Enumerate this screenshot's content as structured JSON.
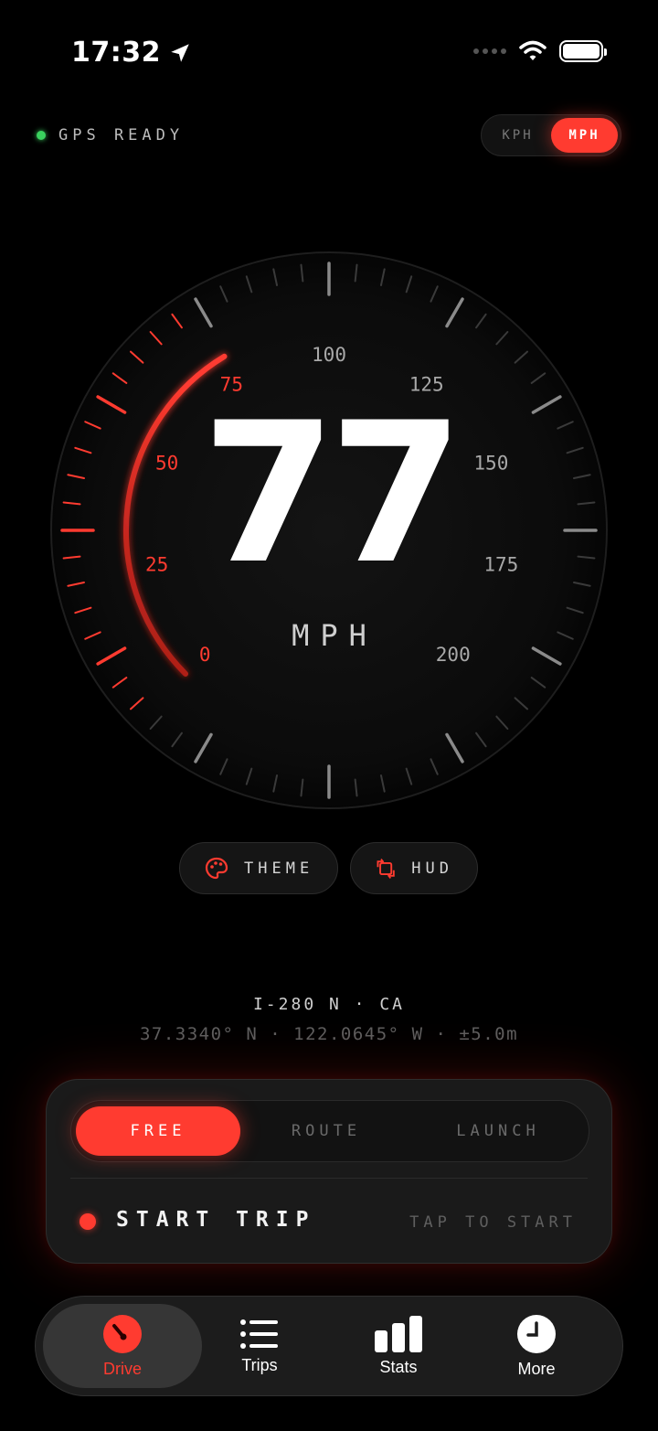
{
  "status_bar": {
    "time": "17:32"
  },
  "gps": {
    "label": "GPS READY"
  },
  "units": {
    "options": [
      "KPH",
      "MPH"
    ],
    "selected": "MPH"
  },
  "gauge": {
    "labels": [
      "0",
      "25",
      "50",
      "75",
      "100",
      "125",
      "150",
      "175",
      "200"
    ],
    "speed": "77",
    "unit": "MPH",
    "max": 200,
    "accent": "#ff3b30"
  },
  "actions": {
    "theme": "THEME",
    "hud": "HUD"
  },
  "location": {
    "road": "I-280 N · CA",
    "coords": "37.3340° N · 122.0645° W · ±5.0m"
  },
  "trip": {
    "modes": [
      "FREE",
      "ROUTE",
      "LAUNCH"
    ],
    "selected_mode": "FREE",
    "start_label": "START TRIP",
    "hint": "TAP TO START"
  },
  "tabs": [
    {
      "label": "Drive",
      "icon": "speedometer-icon",
      "active": true
    },
    {
      "label": "Trips",
      "icon": "list-icon",
      "active": false
    },
    {
      "label": "Stats",
      "icon": "bar-chart-icon",
      "active": false
    },
    {
      "label": "More",
      "icon": "clock-icon",
      "active": false
    }
  ],
  "colors": {
    "accent": "#ff3b30",
    "gps_ok": "#3ad15e",
    "background": "#000000"
  }
}
